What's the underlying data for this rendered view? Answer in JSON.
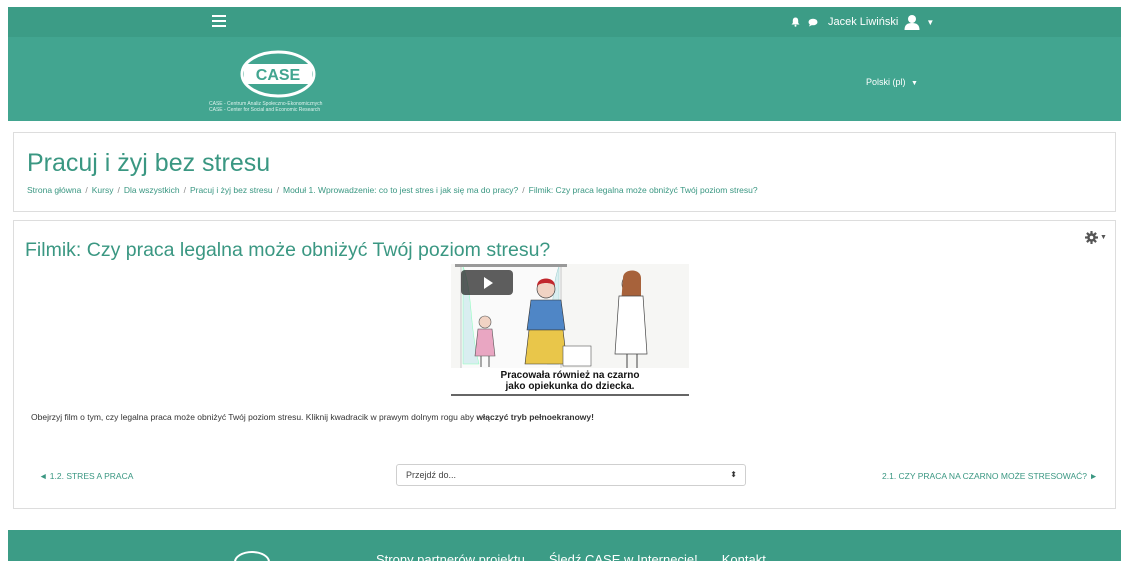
{
  "navbar": {
    "user_name": "Jacek Liwiński",
    "accent": "#3c9c86"
  },
  "header": {
    "logo_text": "CASE",
    "logo_caption_1": "CASE - Centrum Analiz Społeczno-Ekonomicznych",
    "logo_caption_2": "CASE - Center for Social and Economic Research",
    "language": "Polski (pl)"
  },
  "page": {
    "title": "Pracuj i żyj bez stresu",
    "breadcrumb": [
      "Strona główna",
      "Kursy",
      "Dla wszystkich",
      "Pracuj i żyj bez stresu",
      "Moduł 1. Wprowadzenie: co to jest stres i jak się ma do pracy?",
      "Filmik: Czy praca legalna może obniżyć Twój poziom stresu?"
    ]
  },
  "content": {
    "title": "Filmik: Czy praca legalna może obniżyć Twój poziom stresu?",
    "video_subtitle_1": "Pracowała również na czarno",
    "video_subtitle_2": "jako opiekunka do dziecka.",
    "description_start": "Obejrzyj film o tym, czy legalna praca może obniżyć Twój poziom stresu. Kliknij kwadracik w prawym dolnym rogu aby ",
    "description_bold": "włączyć tryb pełnoekranowy!"
  },
  "navigation": {
    "prev_label": "◄ 1.2. STRES A PRACA",
    "jump_placeholder": "Przejdź do...",
    "next_label": "2.1. CZY PRACA NA CZARNO MOŻE STRESOWAĆ? ►"
  },
  "footer": {
    "links": [
      "Strony partnerów projektu",
      "Śledź CASE w Internecie!",
      "Kontakt"
    ]
  }
}
